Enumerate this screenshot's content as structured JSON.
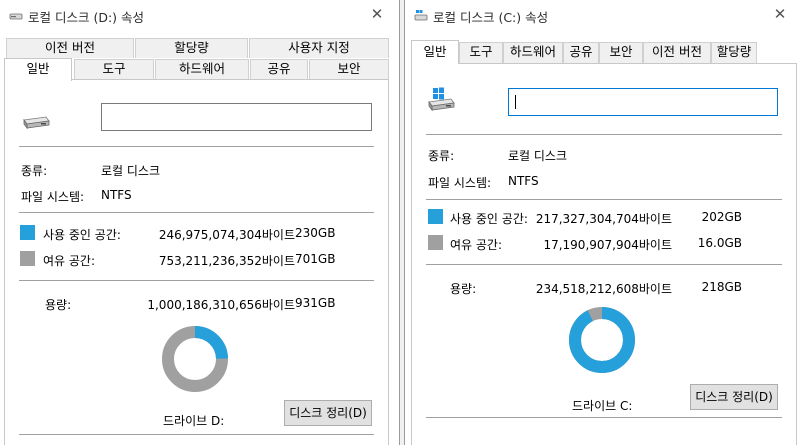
{
  "colors": {
    "used": "#26a0da",
    "free": "#a0a0a0"
  },
  "dialog_d": {
    "title": "로컬 디스크 (D:) 속성",
    "close_glyph": "✕",
    "tabs_back": [
      "이전 버전",
      "할당량",
      "사용자 지정"
    ],
    "tabs_front": [
      "일반",
      "도구",
      "하드웨어",
      "공유",
      "보안"
    ],
    "active_tab": "일반",
    "name_value": "",
    "type_label": "종류:",
    "type_value": "로컬 디스크",
    "fs_label": "파일 시스템:",
    "fs_value": "NTFS",
    "used_label": "사용 중인 공간:",
    "used_bytes": "246,975,074,304바이트",
    "used_size": "230GB",
    "free_label": "여유 공간:",
    "free_bytes": "753,211,236,352바이트",
    "free_size": "701GB",
    "capacity_label": "용량:",
    "capacity_bytes": "1,000,186,310,656바이트",
    "capacity_size": "931GB",
    "used_fraction": 0.247,
    "drive_label": "드라이브 D:",
    "cleanup_label": "디스크 정리(D)"
  },
  "dialog_c": {
    "title": "로컬 디스크 (C:) 속성",
    "close_glyph": "✕",
    "tabs": [
      "일반",
      "도구",
      "하드웨어",
      "공유",
      "보안",
      "이전 버전",
      "할당량"
    ],
    "active_tab": "일반",
    "name_value": "",
    "type_label": "종류:",
    "type_value": "로컬 디스크",
    "fs_label": "파일 시스템:",
    "fs_value": "NTFS",
    "used_label": "사용 중인 공간:",
    "used_bytes": "217,327,304,704바이트",
    "used_size": "202GB",
    "free_label": "여유 공간:",
    "free_bytes": "17,190,907,904바이트",
    "free_size": "16.0GB",
    "capacity_label": "용량:",
    "capacity_bytes": "234,518,212,608바이트",
    "capacity_size": "218GB",
    "used_fraction": 0.927,
    "drive_label": "드라이브 C:",
    "cleanup_label": "디스크 정리(D)"
  }
}
